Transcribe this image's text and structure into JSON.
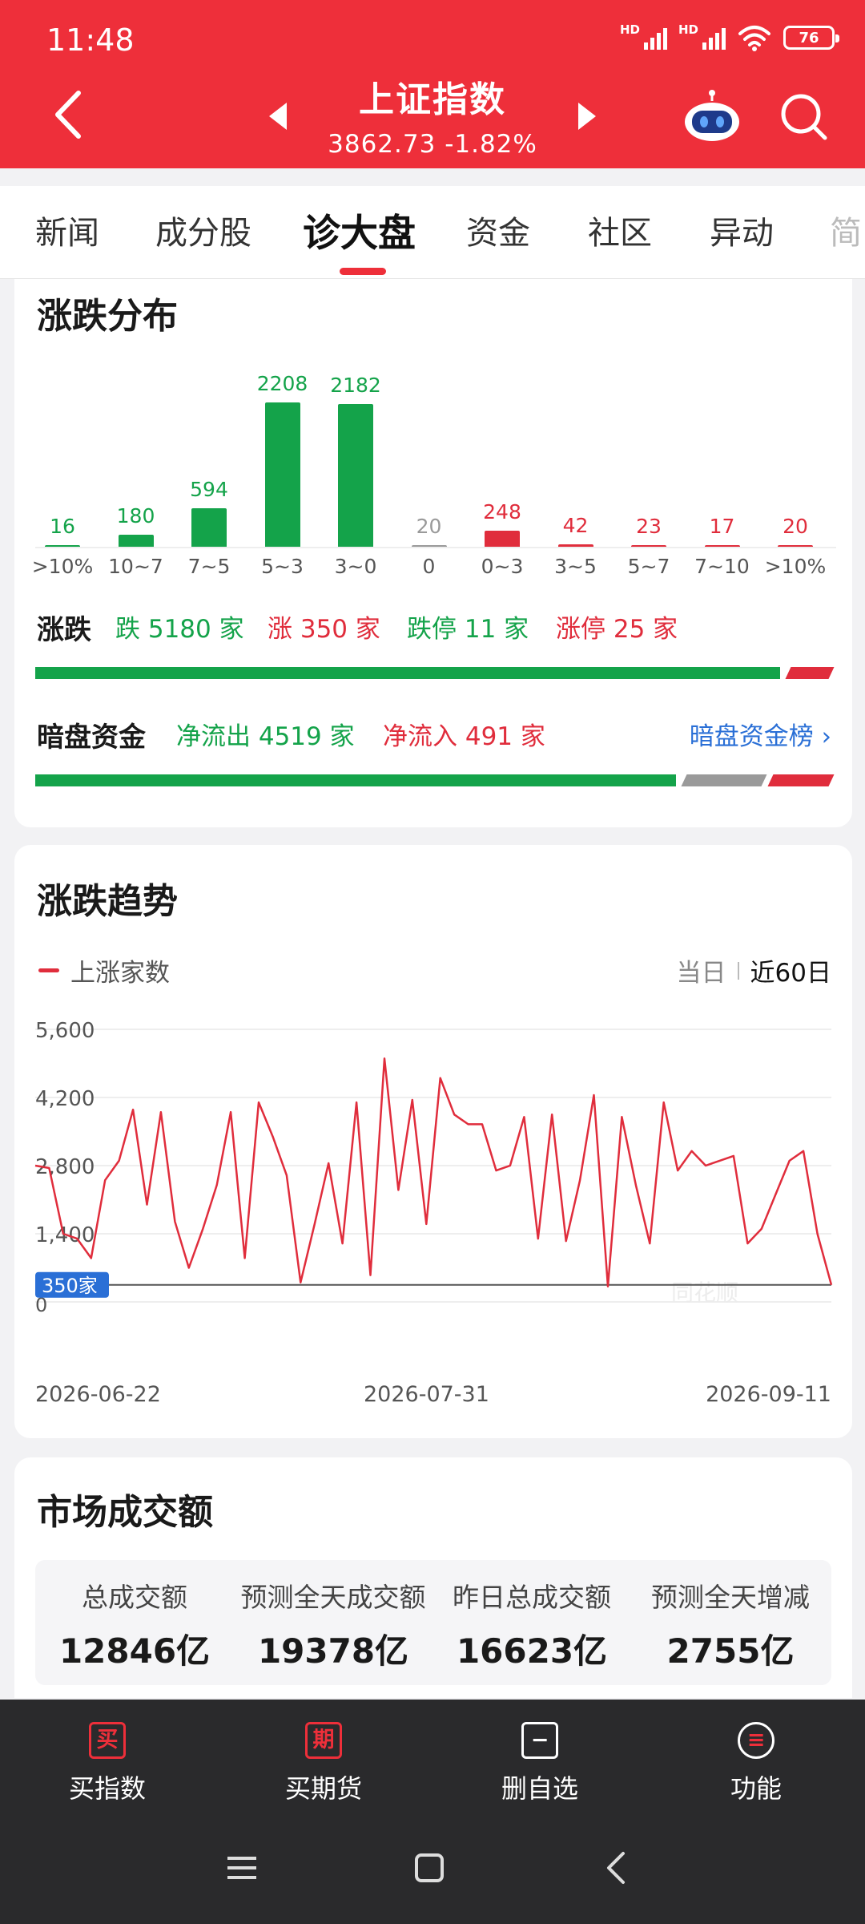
{
  "status_bar": {
    "time": "11:48",
    "signal_label": "HD",
    "battery": "76"
  },
  "header": {
    "title": "上证指数",
    "subtitle": "3862.73  -1.82%"
  },
  "tabs": [
    {
      "label": "新闻"
    },
    {
      "label": "成分股"
    },
    {
      "label": "诊大盘"
    },
    {
      "label": "资金"
    },
    {
      "label": "社区"
    },
    {
      "label": "异动"
    },
    {
      "label": "简"
    }
  ],
  "distribution": {
    "title": "涨跌分布",
    "buckets": [
      {
        "label": ">10%",
        "value": 16,
        "dir": "down"
      },
      {
        "label": "10~7",
        "value": 180,
        "dir": "down"
      },
      {
        "label": "7~5",
        "value": 594,
        "dir": "down"
      },
      {
        "label": "5~3",
        "value": 2208,
        "dir": "down"
      },
      {
        "label": "3~0",
        "value": 2182,
        "dir": "down"
      },
      {
        "label": "0",
        "value": 20,
        "dir": "flat"
      },
      {
        "label": "0~3",
        "value": 248,
        "dir": "up"
      },
      {
        "label": "3~5",
        "value": 42,
        "dir": "up"
      },
      {
        "label": "5~7",
        "value": 23,
        "dir": "up"
      },
      {
        "label": "7~10",
        "value": 17,
        "dir": "up"
      },
      {
        "label": ">10%",
        "value": 20,
        "dir": "up"
      }
    ],
    "updown": {
      "label": "涨跌",
      "fall": "跌 5180 家",
      "rise": "涨 350 家",
      "limit_down": "跌停 11 家",
      "limit_up": "涨停 25 家"
    },
    "dark_pool": {
      "label": "暗盘资金",
      "outflow": "净流出 4519 家",
      "inflow": "净流入 491 家",
      "rank_link": "暗盘资金榜 ›"
    },
    "colors": {
      "green": "#14a34a",
      "red": "#e02d3c",
      "gray": "#9a9a9a"
    }
  },
  "trend": {
    "title": "涨跌趋势",
    "legend": "上涨家数",
    "range_today": "当日",
    "range_60": "近60日",
    "current_tag": "350家",
    "watermark": "同花顺"
  },
  "chart_data": {
    "type": "line",
    "title": "涨跌趋势",
    "series": [
      {
        "name": "上涨家数",
        "values": [
          2800,
          2750,
          1400,
          1300,
          900,
          2500,
          2900,
          3950,
          2000,
          3900,
          1650,
          700,
          1500,
          2400,
          3900,
          900,
          4100,
          3400,
          2600,
          400,
          1600,
          2850,
          1200,
          4100,
          550,
          5000,
          2300,
          4150,
          1600,
          4600,
          3850,
          3650,
          3650,
          2700,
          2800,
          3800,
          1300,
          3850,
          1250,
          2500,
          4250,
          320,
          3800,
          2400,
          1200,
          4100,
          2700,
          3100,
          2800,
          2900,
          3000,
          1200,
          1500,
          2200,
          2900,
          3100,
          1400,
          350
        ]
      }
    ],
    "x_start": "2026-06-22",
    "x_mid": "2026-07-31",
    "x_end": "2026-09-11",
    "y_ticks": [
      "5,600",
      "4,200",
      "2,800",
      "1,400",
      "0"
    ],
    "ylim": [
      0,
      5600
    ]
  },
  "volume": {
    "title": "市场成交额",
    "items": [
      {
        "label": "总成交额",
        "value": "12846亿"
      },
      {
        "label": "预测全天成交额",
        "value": "19378亿"
      },
      {
        "label": "昨日总成交额",
        "value": "16623亿"
      },
      {
        "label": "预测全天增减",
        "value": "2755亿"
      }
    ]
  },
  "bottom_nav": [
    {
      "icon_text": "买",
      "label": "买指数"
    },
    {
      "icon_text": "期",
      "label": "买期货"
    },
    {
      "icon_text": "−",
      "label": "删自选"
    },
    {
      "icon_text": "≡",
      "label": "功能"
    }
  ]
}
